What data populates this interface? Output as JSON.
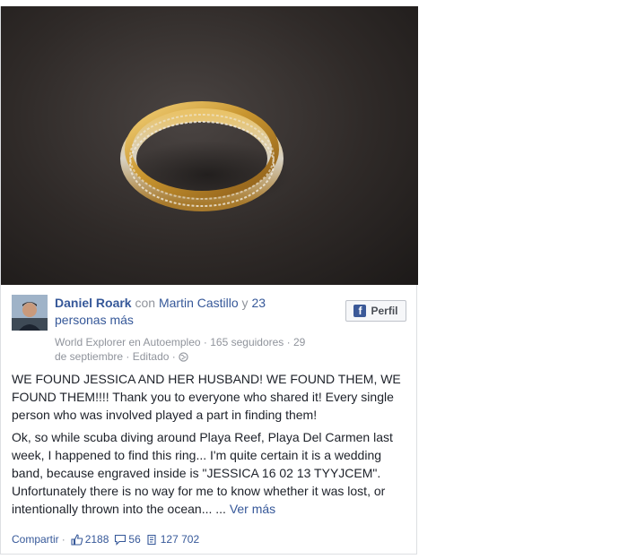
{
  "post": {
    "author": "Daniel Roark",
    "with_word": "con",
    "tagged": "Martin Castillo",
    "and_word": "y",
    "others": "23 personas más",
    "page_name": "World Explorer",
    "in_word": "en",
    "category": "Autoempleo",
    "followers": "165 seguidores",
    "date": "29 de septiembre",
    "edited": "Editado",
    "profile_button": "Perfil",
    "paragraph1": "WE FOUND JESSICA AND HER HUSBAND! WE FOUND THEM, WE FOUND THEM!!!! Thank you to everyone who shared it! Every single person who was involved played a part in finding them!",
    "paragraph2": "Ok, so while scuba diving around Playa Reef, Playa Del Carmen last week, I happened to find this ring... I'm quite certain it is a wedding band, because engraved inside is \"JESSICA 16 02 13 TYYJCEM\". Unfortunately there is no way for me to know whether it was lost, or intentionally thrown into the ocean...",
    "ellipsis": "...",
    "see_more": "Ver más"
  },
  "footer": {
    "share": "Compartir",
    "likes": "2188",
    "comments": "56",
    "shares": "127 702"
  },
  "icons": {
    "profile_button": "facebook-f-icon",
    "globe": "globe-icon",
    "like": "thumbs-up-icon",
    "comment": "comment-icon",
    "share": "share-icon"
  },
  "colors": {
    "link": "#365899",
    "muted": "#90949c",
    "text": "#1d2129",
    "facebook_blue": "#3b5998"
  }
}
